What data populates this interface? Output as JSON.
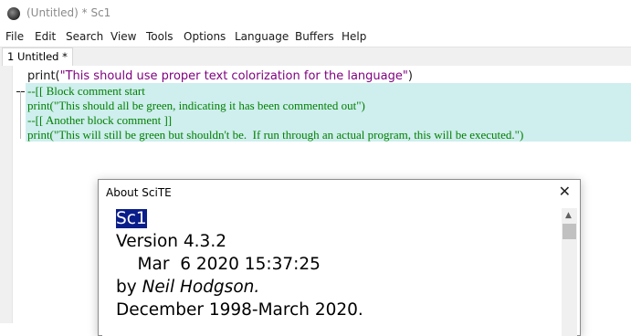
{
  "window": {
    "title": "(Untitled) * Sc1"
  },
  "menu": [
    "File",
    "Edit",
    "Search",
    "View",
    "Tools",
    "Options",
    "Language",
    "Buffers",
    "Help"
  ],
  "tab": {
    "label": "1 Untitled *"
  },
  "editor": {
    "line1_prefix": "print(",
    "line1_string": "\"This should use proper text colorization for the language\"",
    "line1_suffix": ")",
    "comment_lines": [
      "--[[ Block comment start",
      "print(\"This should all be green, indicating it has been commented out\")",
      "--[[ Another block comment ]]",
      "print(\"This will still be green but shouldn't be.  If run through an actual program, this will be executed.\")"
    ]
  },
  "about": {
    "title": "About SciTE",
    "close": "✕",
    "app_name": "Sc1",
    "version": "Version 4.3.2",
    "date": "    Mar  6 2020 15:37:25",
    "by": "by ",
    "author": "Neil Hodgson.",
    "period": "December 1998-March 2020."
  },
  "colors": {
    "comment_background": "#cfeeee",
    "comment_text": "#008000",
    "string_text": "#7f007f",
    "selection": "#0a1e8a"
  }
}
